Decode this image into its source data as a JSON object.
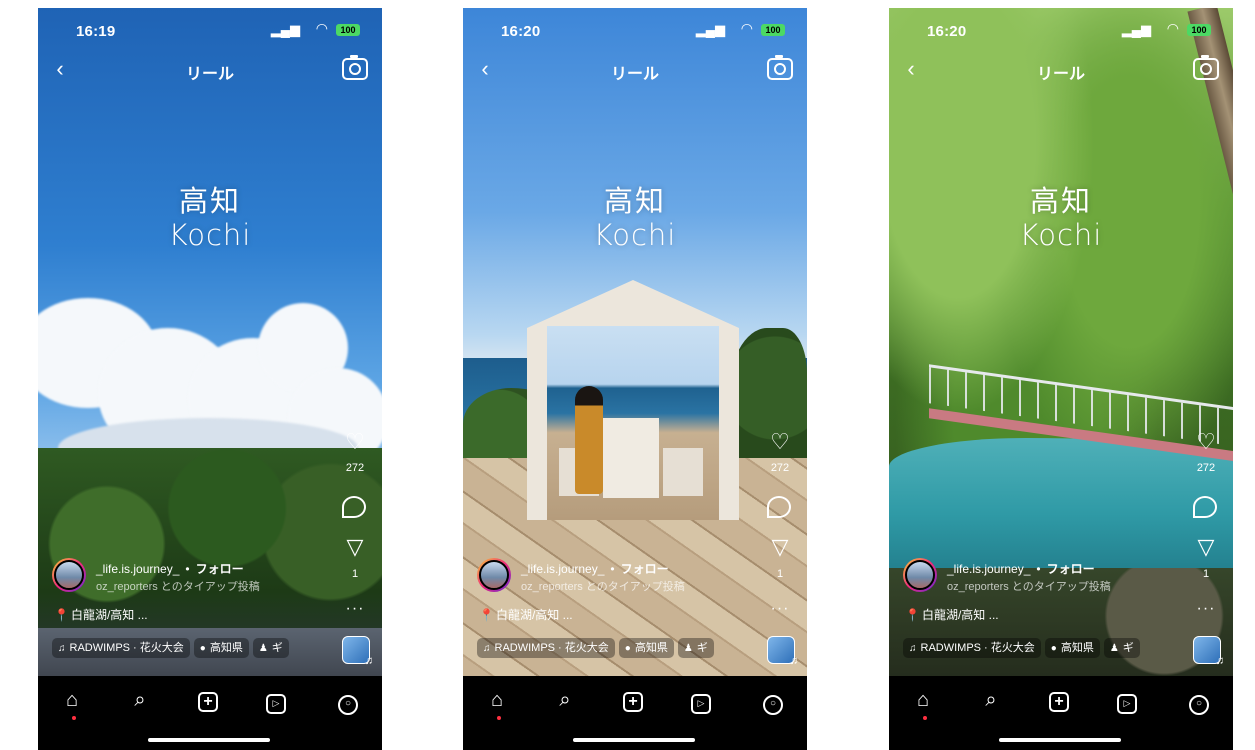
{
  "status_bar": {
    "signal": "▂▄▆",
    "wifi": "◠",
    "battery": "100"
  },
  "nav": {
    "back": "‹",
    "title": "リール"
  },
  "overlay": {
    "jp": "高知",
    "en": "Kochi"
  },
  "actions": {
    "heart": "♡",
    "likes": "272",
    "share": "▽",
    "shares": "1",
    "more": "···"
  },
  "post": {
    "username": "_life.is.journey_",
    "separator": "•",
    "follow": "フォロー",
    "collab": "oz_reporters とのタイアップ投稿",
    "location_pin": "📍",
    "location_text": "白龍湖/高知 ..."
  },
  "chips": {
    "music_icon": "♫",
    "music": "RADWIMPS · 花火大会",
    "place_icon": "●",
    "place": "高知県",
    "people_icon": "♟",
    "people": "ギ"
  },
  "tabbar": {
    "home": "⌂",
    "search": "⌕",
    "create": "+",
    "reels": "▷",
    "profile": "○"
  },
  "phones": [
    {
      "time": "16:19"
    },
    {
      "time": "16:20"
    },
    {
      "time": "16:20"
    }
  ],
  "icons": [
    "back-icon",
    "camera-icon",
    "heart-icon",
    "comment-icon",
    "share-icon",
    "more-icon",
    "music-icon",
    "location-icon",
    "people-icon",
    "home-icon",
    "search-icon",
    "create-icon",
    "reels-icon",
    "profile-icon"
  ]
}
